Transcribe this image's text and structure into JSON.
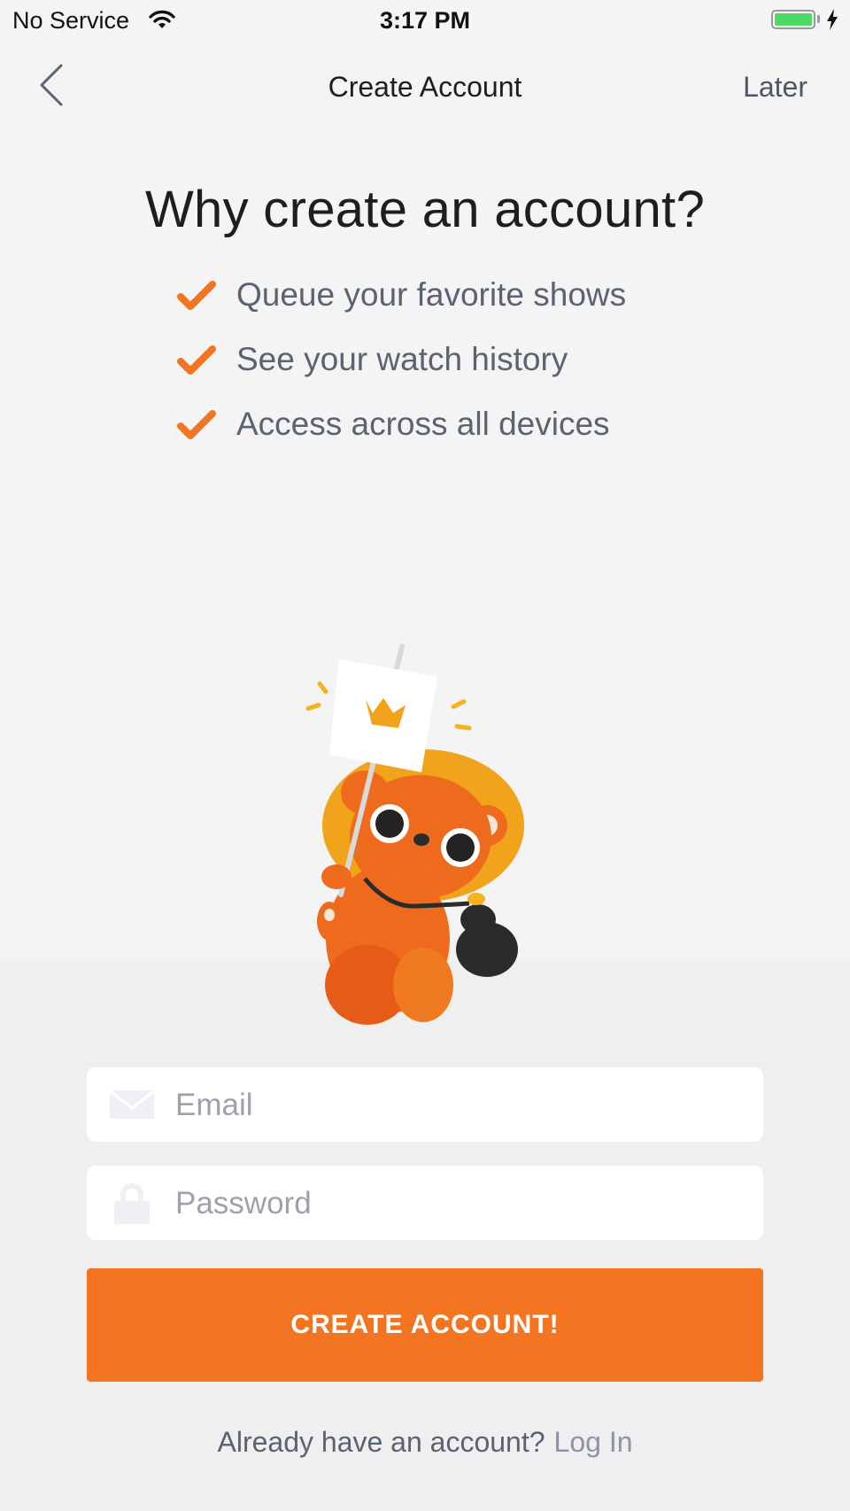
{
  "status_bar": {
    "carrier": "No Service",
    "time": "3:17 PM",
    "battery_level": 1.0
  },
  "nav": {
    "title": "Create Account",
    "later_label": "Later"
  },
  "hero": {
    "headline": "Why create an account?",
    "benefits": [
      "Queue your favorite shows",
      "See your watch history",
      "Access across all devices"
    ]
  },
  "form": {
    "email_placeholder": "Email",
    "password_placeholder": "Password",
    "submit_label": "CREATE ACCOUNT!"
  },
  "footer": {
    "prompt": "Already have an account?",
    "login_label": "Log In"
  },
  "icons": {
    "back": "chevron-left-icon",
    "check": "checkmark-icon",
    "email": "envelope-icon",
    "password": "lock-icon"
  },
  "colors": {
    "accent": "#f47521",
    "battery": "#4cd964",
    "secondary_text": "#5b6270"
  }
}
